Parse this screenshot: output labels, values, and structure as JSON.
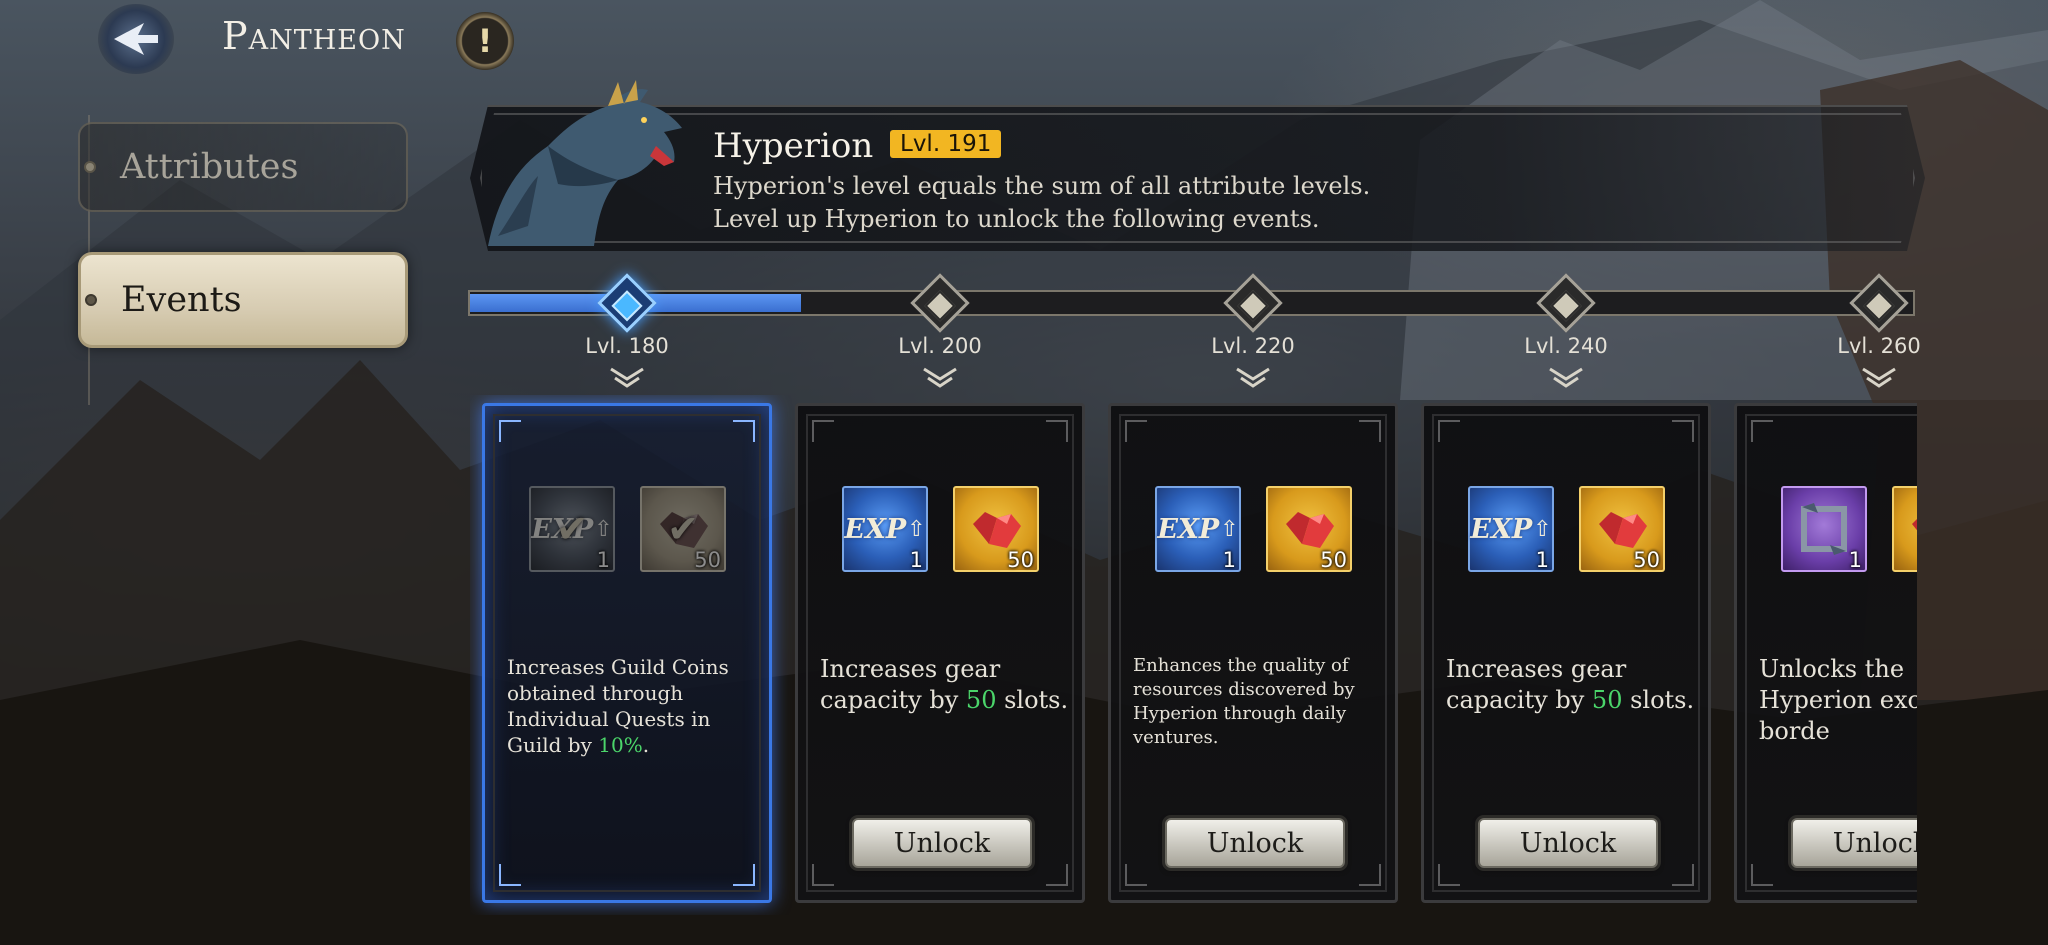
{
  "header": {
    "title": "Pantheon",
    "back_icon": "back-arrow-icon",
    "info_glyph": "!"
  },
  "nav": {
    "items": [
      {
        "label": "Attributes",
        "selected": false
      },
      {
        "label": "Events",
        "selected": true
      }
    ]
  },
  "hero": {
    "name": "Hyperion",
    "level": "Lvl. 191",
    "description_line1": "Hyperion's level equals the sum of all attribute levels.",
    "description_line2": "Level up Hyperion to unlock the following events."
  },
  "progress": {
    "milestones": [
      "Lvl. 180",
      "Lvl. 200",
      "Lvl. 220",
      "Lvl. 240",
      "Lvl. 260"
    ],
    "current_level": 191,
    "active_milestone": 0
  },
  "cards": [
    {
      "milestone": "Lvl. 180",
      "state": "unlocked",
      "rewards": [
        {
          "type": "exp",
          "label": "EXP",
          "qty": "1",
          "claimed": true
        },
        {
          "type": "gem",
          "qty": "50",
          "claimed": true
        }
      ],
      "desc_before": "Increases Guild Coins obtained through Individual Quests in Guild by ",
      "desc_highlight": "10%",
      "desc_after": "."
    },
    {
      "milestone": "Lvl. 200",
      "state": "locked",
      "rewards": [
        {
          "type": "exp",
          "label": "EXP",
          "qty": "1",
          "claimed": false
        },
        {
          "type": "gem",
          "qty": "50",
          "claimed": false
        }
      ],
      "desc_before": "Increases gear capacity by ",
      "desc_highlight": "50",
      "desc_after": " slots.",
      "button": "Unlock"
    },
    {
      "milestone": "Lvl. 220",
      "state": "locked",
      "rewards": [
        {
          "type": "exp",
          "label": "EXP",
          "qty": "1",
          "claimed": false
        },
        {
          "type": "gem",
          "qty": "50",
          "claimed": false
        }
      ],
      "desc_before": "Enhances the quality of resources discovered by Hyperion through daily ventures.",
      "desc_highlight": "",
      "desc_after": "",
      "button": "Unlock"
    },
    {
      "milestone": "Lvl. 240",
      "state": "locked",
      "rewards": [
        {
          "type": "exp",
          "label": "EXP",
          "qty": "1",
          "claimed": false
        },
        {
          "type": "gem",
          "qty": "50",
          "claimed": false
        }
      ],
      "desc_before": "Increases gear capacity by ",
      "desc_highlight": "50",
      "desc_after": " slots.",
      "button": "Unlock"
    },
    {
      "milestone": "Lvl. 260",
      "state": "locked",
      "rewards": [
        {
          "type": "avatar-border",
          "qty": "1",
          "claimed": false
        },
        {
          "type": "gem",
          "qty": "",
          "claimed": false
        }
      ],
      "desc_before": "Unlocks the Hyperion exc avatar borde",
      "desc_highlight": "",
      "desc_after": "",
      "button": "Unlock"
    }
  ],
  "colors": {
    "accent_blue": "#3a78e6",
    "highlight_green": "#4bd56a",
    "level_badge": "#f2b622"
  }
}
